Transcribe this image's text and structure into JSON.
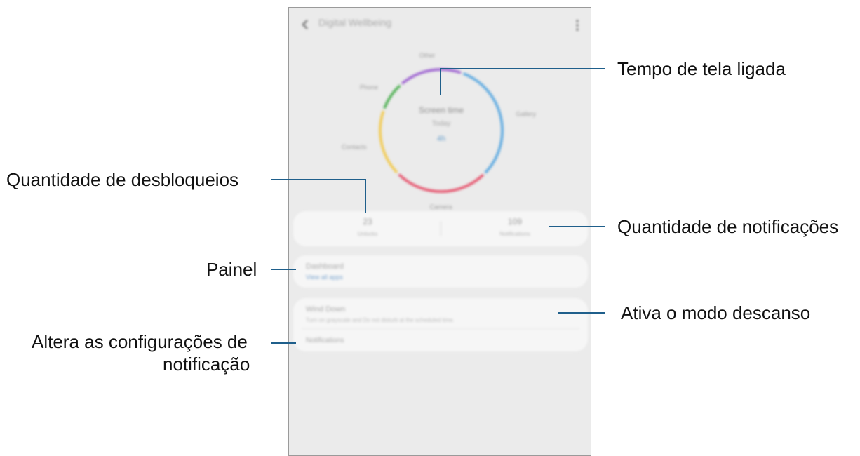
{
  "screen": {
    "title": "Digital Wellbeing",
    "chart_data": {
      "type": "pie",
      "categories": [
        "Gallery",
        "Camera",
        "Contacts",
        "Phone",
        "Other"
      ],
      "values": [
        32,
        25,
        18,
        8,
        17
      ],
      "colors": [
        "#5aa8e0",
        "#e6506a",
        "#f2c94c",
        "#4caf50",
        "#9b5fd0"
      ],
      "center_line1": "Screen time",
      "center_line2": "Today",
      "center_value": "4h"
    },
    "stats": {
      "left_value": "23",
      "left_label": "Unlocks",
      "right_value": "109",
      "right_label": "Notifications"
    },
    "dashboard": {
      "title": "Dashboard",
      "link": "View all apps"
    },
    "wind_down": {
      "title": "Wind Down",
      "desc": "Turn on grayscale and Do not disturb at the scheduled time.",
      "notifications_title": "Notifications"
    }
  },
  "callouts": {
    "screen_time": "Tempo de tela ligada",
    "unlocks": "Quantidade de desbloqueios",
    "notifications": "Quantidade de notificações",
    "dashboard": "Painel",
    "wind_down": "Ativa o modo descanso",
    "notif_settings_line1": "Altera as configurações de",
    "notif_settings_line2": "notificação"
  },
  "colors": {
    "line": "#1f5f8b"
  }
}
